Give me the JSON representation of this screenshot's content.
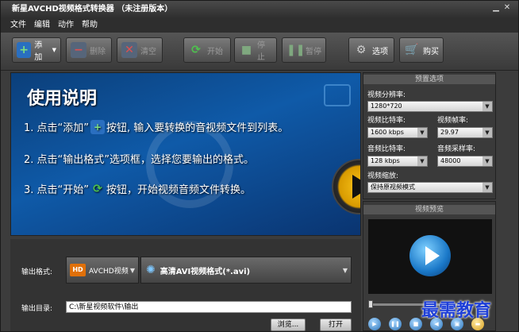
{
  "window": {
    "title": "新星AVCHD视频格式转换器 （未注册版本）"
  },
  "menu": [
    "文件",
    "编辑",
    "动作",
    "帮助"
  ],
  "toolbar": {
    "add": "添加",
    "delete": "删除",
    "clear": "清空",
    "start": "开始",
    "stop": "停止",
    "pause": "暂停",
    "options": "选项",
    "buy": "购买"
  },
  "guide": {
    "title": "使用说明",
    "step1_a": "1. 点击“添加”",
    "step1_b": "按钮, 输入要转换的音视频文件到列表。",
    "step2": "2. 点击“输出格式”选项框，选择您要输出的格式。",
    "step3_a": "3. 点击“开始”",
    "step3_b": "按钮，开始视频音频文件转换。"
  },
  "output": {
    "format_label": "输出格式:",
    "format_category": "AVCHD视频",
    "format_badge": "HD",
    "format_value": "高清AVI视频格式(*.avi)",
    "dir_label": "输出目录:",
    "dir_value": "C:\\新星视频软件\\输出",
    "browse": "浏览...",
    "open": "打开"
  },
  "preset": {
    "header": "预置选项",
    "resolution_label": "视频分辨率:",
    "resolution_value": "1280*720",
    "vbitrate_label": "视频比特率:",
    "vbitrate_value": "1600 kbps",
    "framerate_label": "视频帧率:",
    "framerate_value": "29.97",
    "abitrate_label": "音频比特率:",
    "abitrate_value": "128 kbps",
    "samplerate_label": "音频采样率:",
    "samplerate_value": "48000",
    "scale_label": "视频缩放:",
    "scale_value": "保持原视频模式"
  },
  "preview": {
    "header": "视频预览"
  },
  "watermark": "最需教育",
  "colors": {
    "accent": "#1a78c8",
    "disc": "#f7c21a",
    "watermark": "#1e3fd8"
  }
}
